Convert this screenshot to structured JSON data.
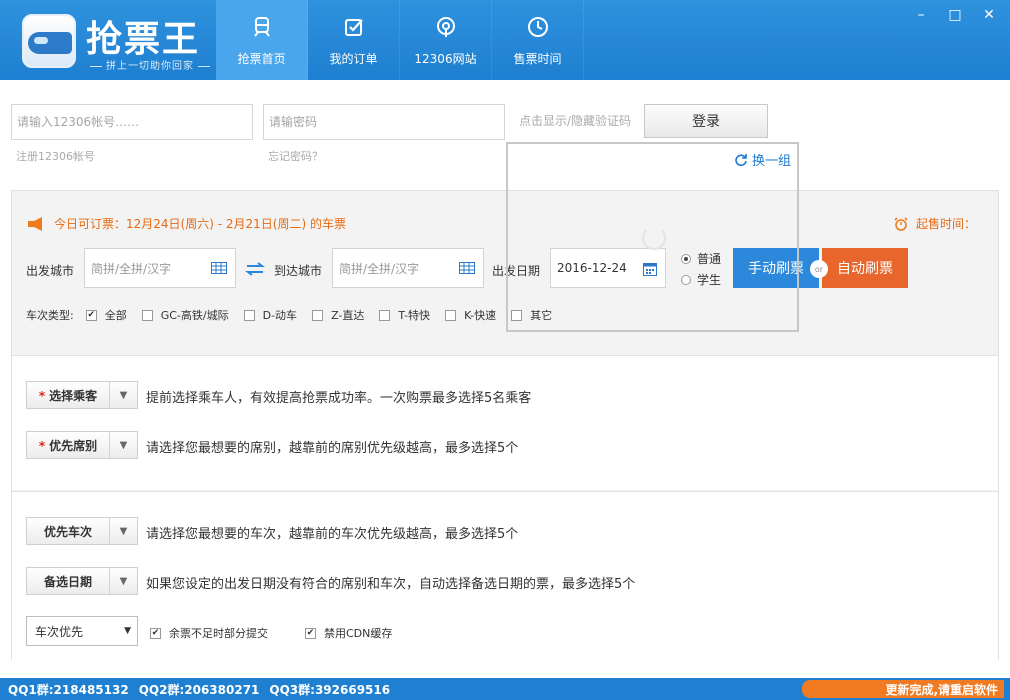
{
  "app": {
    "name": "抢票王",
    "slogan": "拼上一切助你回家"
  },
  "nav": [
    {
      "label": "抢票首页",
      "icon": "train-icon",
      "active": true
    },
    {
      "label": "我的订单",
      "icon": "checkbox-icon",
      "active": false
    },
    {
      "label": "12306网站",
      "icon": "map-pin-icon",
      "active": false
    },
    {
      "label": "售票时间",
      "icon": "clock-icon",
      "active": false
    }
  ],
  "window": {
    "minimize": "–",
    "maximize": "□",
    "close": "✕"
  },
  "login": {
    "account_placeholder": "请输入12306帐号……",
    "password_placeholder": "请输密码",
    "captcha_toggle": "点击显示/隐藏验证码",
    "login_button": "登录",
    "register": "注册12306帐号",
    "forgot": "忘记密码？",
    "refresh": "换一组"
  },
  "search": {
    "notice": "今日可订票：12月24日(周六) - 2月21日(周二) 的车票",
    "sale_time": "起售时间：",
    "from_label": "出发城市",
    "from_placeholder": "简拼/全拼/汉字",
    "to_label": "到达城市",
    "to_placeholder": "简拼/全拼/汉字",
    "date_label": "出发日期",
    "date_value": "2016-12-24",
    "ticket_types": [
      {
        "label": "普通",
        "checked": true
      },
      {
        "label": "学生",
        "checked": false
      }
    ],
    "manual_button": "手动刷票",
    "auto_button": "自动刷票",
    "or": "or",
    "train_type_label": "车次类型:",
    "train_types": [
      {
        "label": "全部",
        "checked": true
      },
      {
        "label": "GC-高铁/城际",
        "checked": false
      },
      {
        "label": "D-动车",
        "checked": false
      },
      {
        "label": "Z-直达",
        "checked": false
      },
      {
        "label": "T-特快",
        "checked": false
      },
      {
        "label": "K-快速",
        "checked": false
      },
      {
        "label": "其它",
        "checked": false
      }
    ]
  },
  "prefs": {
    "passengers_label": "选择乘客",
    "passengers_desc": "提前选择乘车人，有效提高抢票成功率。一次购票最多选择5名乘客",
    "seats_label": "优先席别",
    "seats_desc": "请选择您最想要的席别，越靠前的席别优先级越高，最多选择5个",
    "trains_label": "优先车次",
    "trains_desc": "请选择您最想要的车次，越靠前的车次优先级越高，最多选择5个",
    "dates_label": "备选日期",
    "dates_desc": "如果您设定的出发日期没有符合的席别和车次，自动选择备选日期的票，最多选择5个",
    "priority_select": "车次优先",
    "partial_submit": "余票不足时部分提交",
    "disable_cdn": "禁用CDN缓存"
  },
  "footer": {
    "qq1": "QQ1群:218485132",
    "qq2": "QQ2群:206380271",
    "qq3": "QQ3群:392669516",
    "update": "更新完成,请重启软件"
  }
}
